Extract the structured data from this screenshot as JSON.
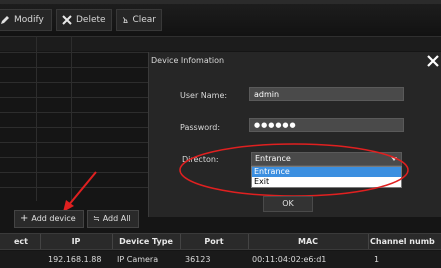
{
  "toolbar": {
    "modify_label": "Modify",
    "delete_label": "Delete",
    "clear_label": "Clear"
  },
  "dialog": {
    "title": "Device Infomation",
    "username_label": "User Name:",
    "username_value": "admin",
    "password_label": "Password:",
    "password_value": "●●●●●●",
    "direction_label": "Directon:",
    "direction_value": "Entrance",
    "direction_options": [
      "Entrance",
      "Exit"
    ],
    "ok_label": "OK"
  },
  "actions": {
    "add_device_label": "Add device",
    "add_all_label": "Add All"
  },
  "table": {
    "headers": [
      "ect",
      "IP",
      "Device Type",
      "Port",
      "MAC",
      "Channel numb"
    ],
    "rows": [
      [
        "",
        "192.168.1.88",
        "IP Camera",
        "36123",
        "00:11:04:02:e6:d1",
        "1"
      ]
    ]
  },
  "colors": {
    "selection_blue": "#3b8fe0",
    "annotation_red": "#e02020"
  }
}
